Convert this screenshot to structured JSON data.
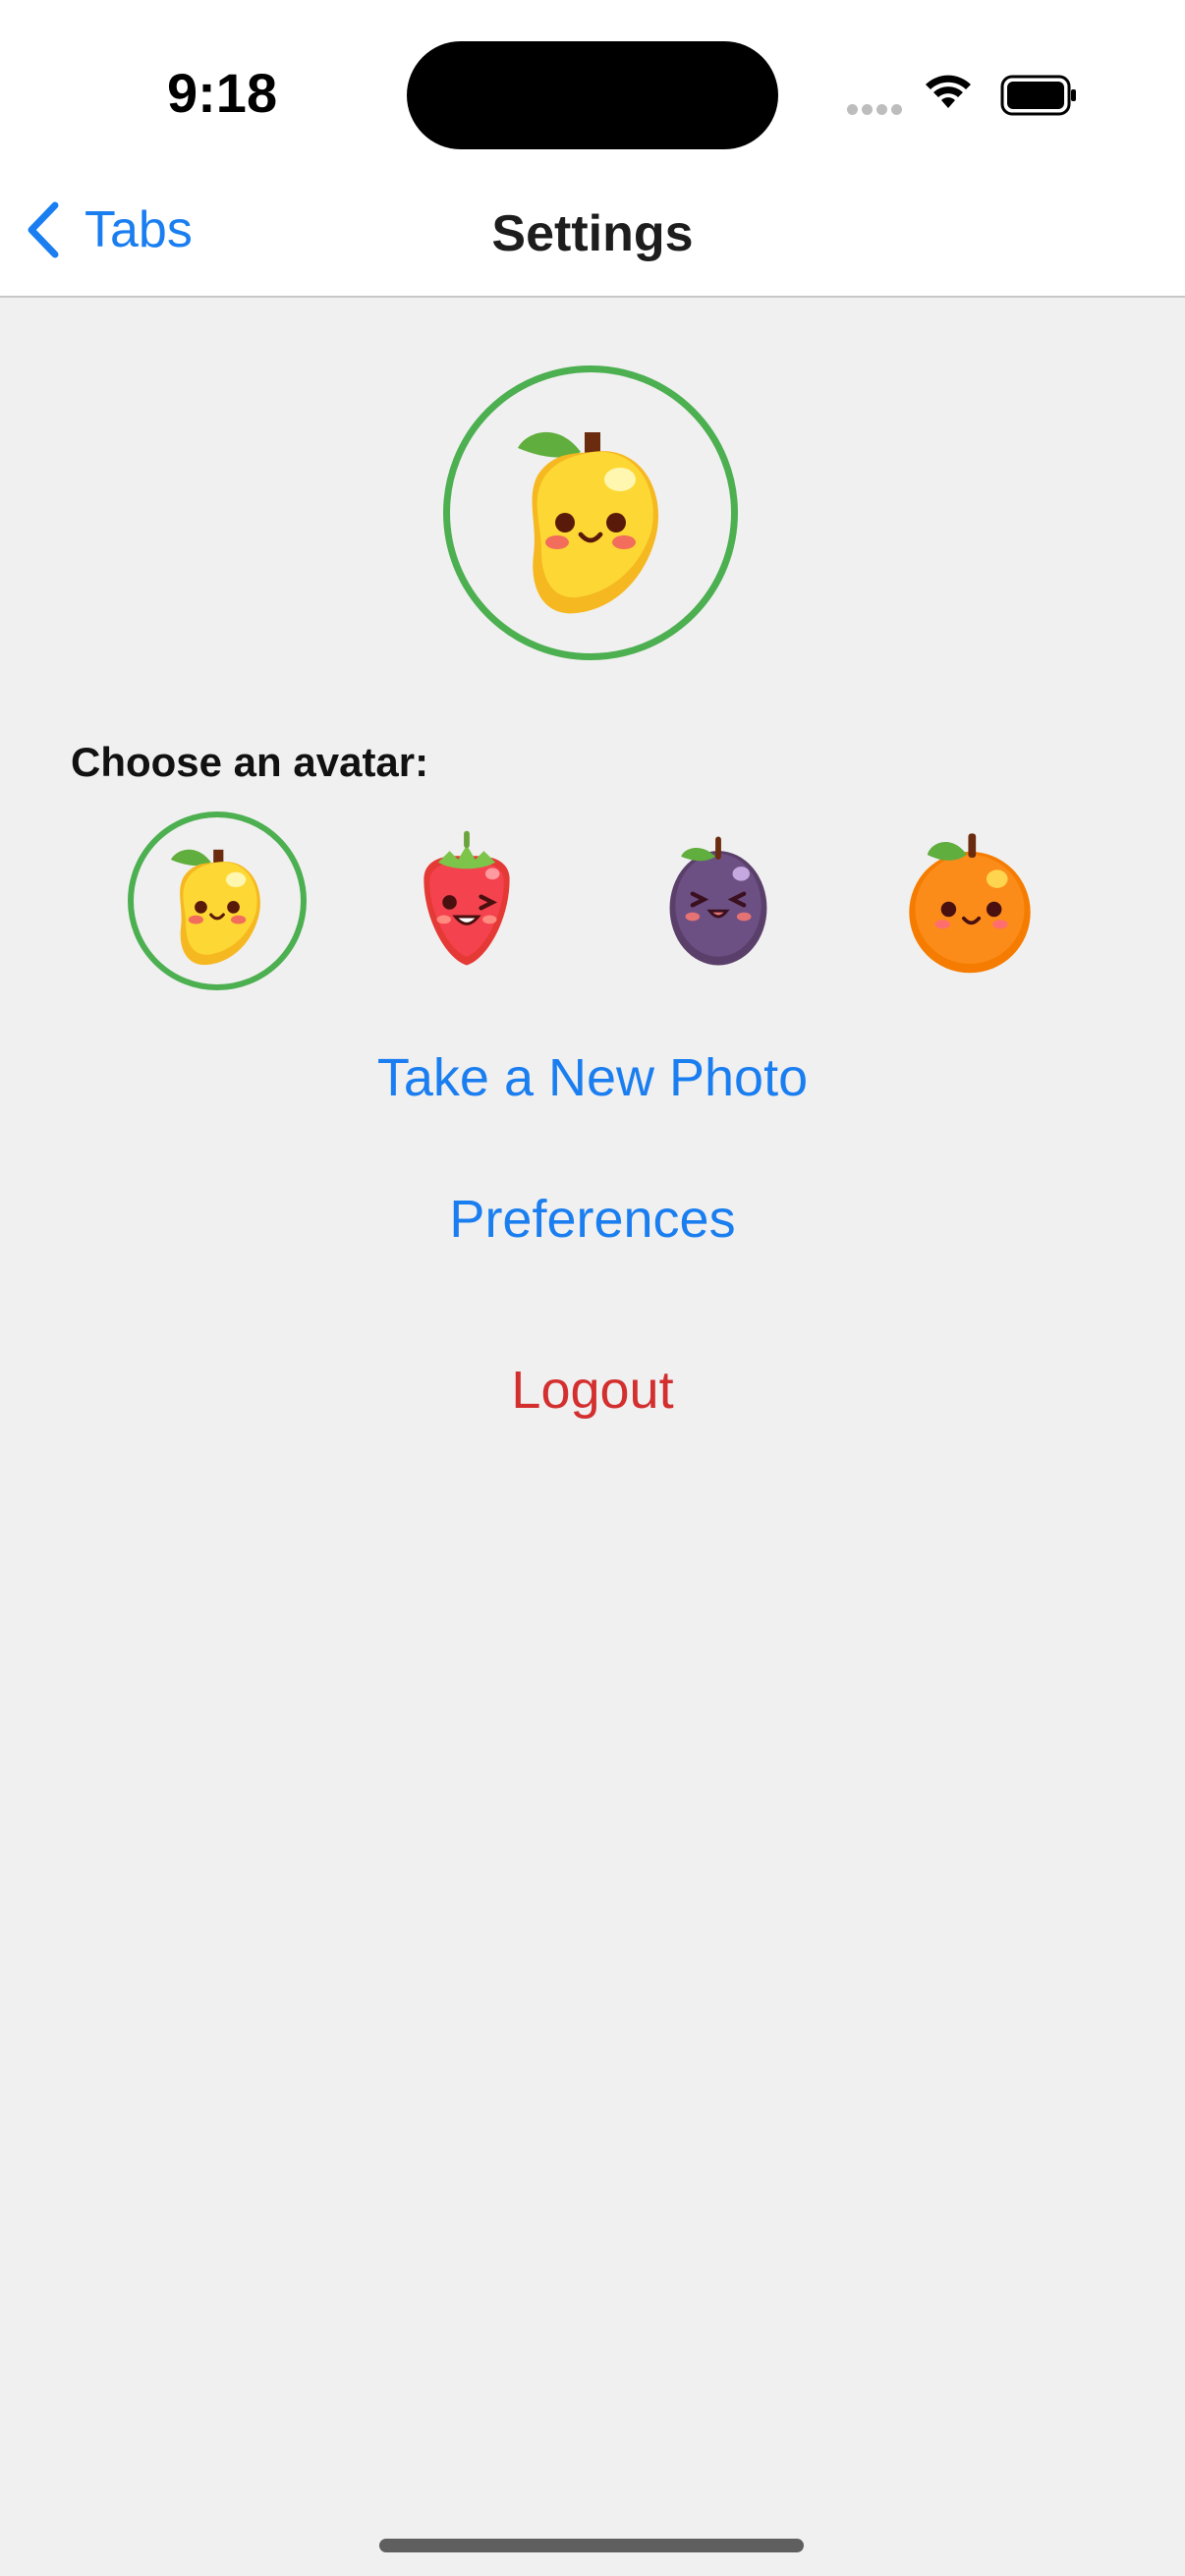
{
  "status_bar": {
    "time": "9:18"
  },
  "nav": {
    "back_label": "Tabs",
    "title": "Settings"
  },
  "avatar": {
    "current": "mango",
    "choose_label": "Choose an avatar:",
    "options": [
      {
        "icon": "mango-icon",
        "selected": true
      },
      {
        "icon": "strawberry-icon",
        "selected": false
      },
      {
        "icon": "plum-icon",
        "selected": false
      },
      {
        "icon": "orange-icon",
        "selected": false
      }
    ]
  },
  "actions": {
    "take_photo": "Take a New Photo",
    "preferences": "Preferences",
    "logout": "Logout"
  },
  "colors": {
    "accent": "#1a7ef0",
    "selected_ring": "#4caf50",
    "logout": "#d32f2f",
    "background": "#f0f0f0"
  }
}
